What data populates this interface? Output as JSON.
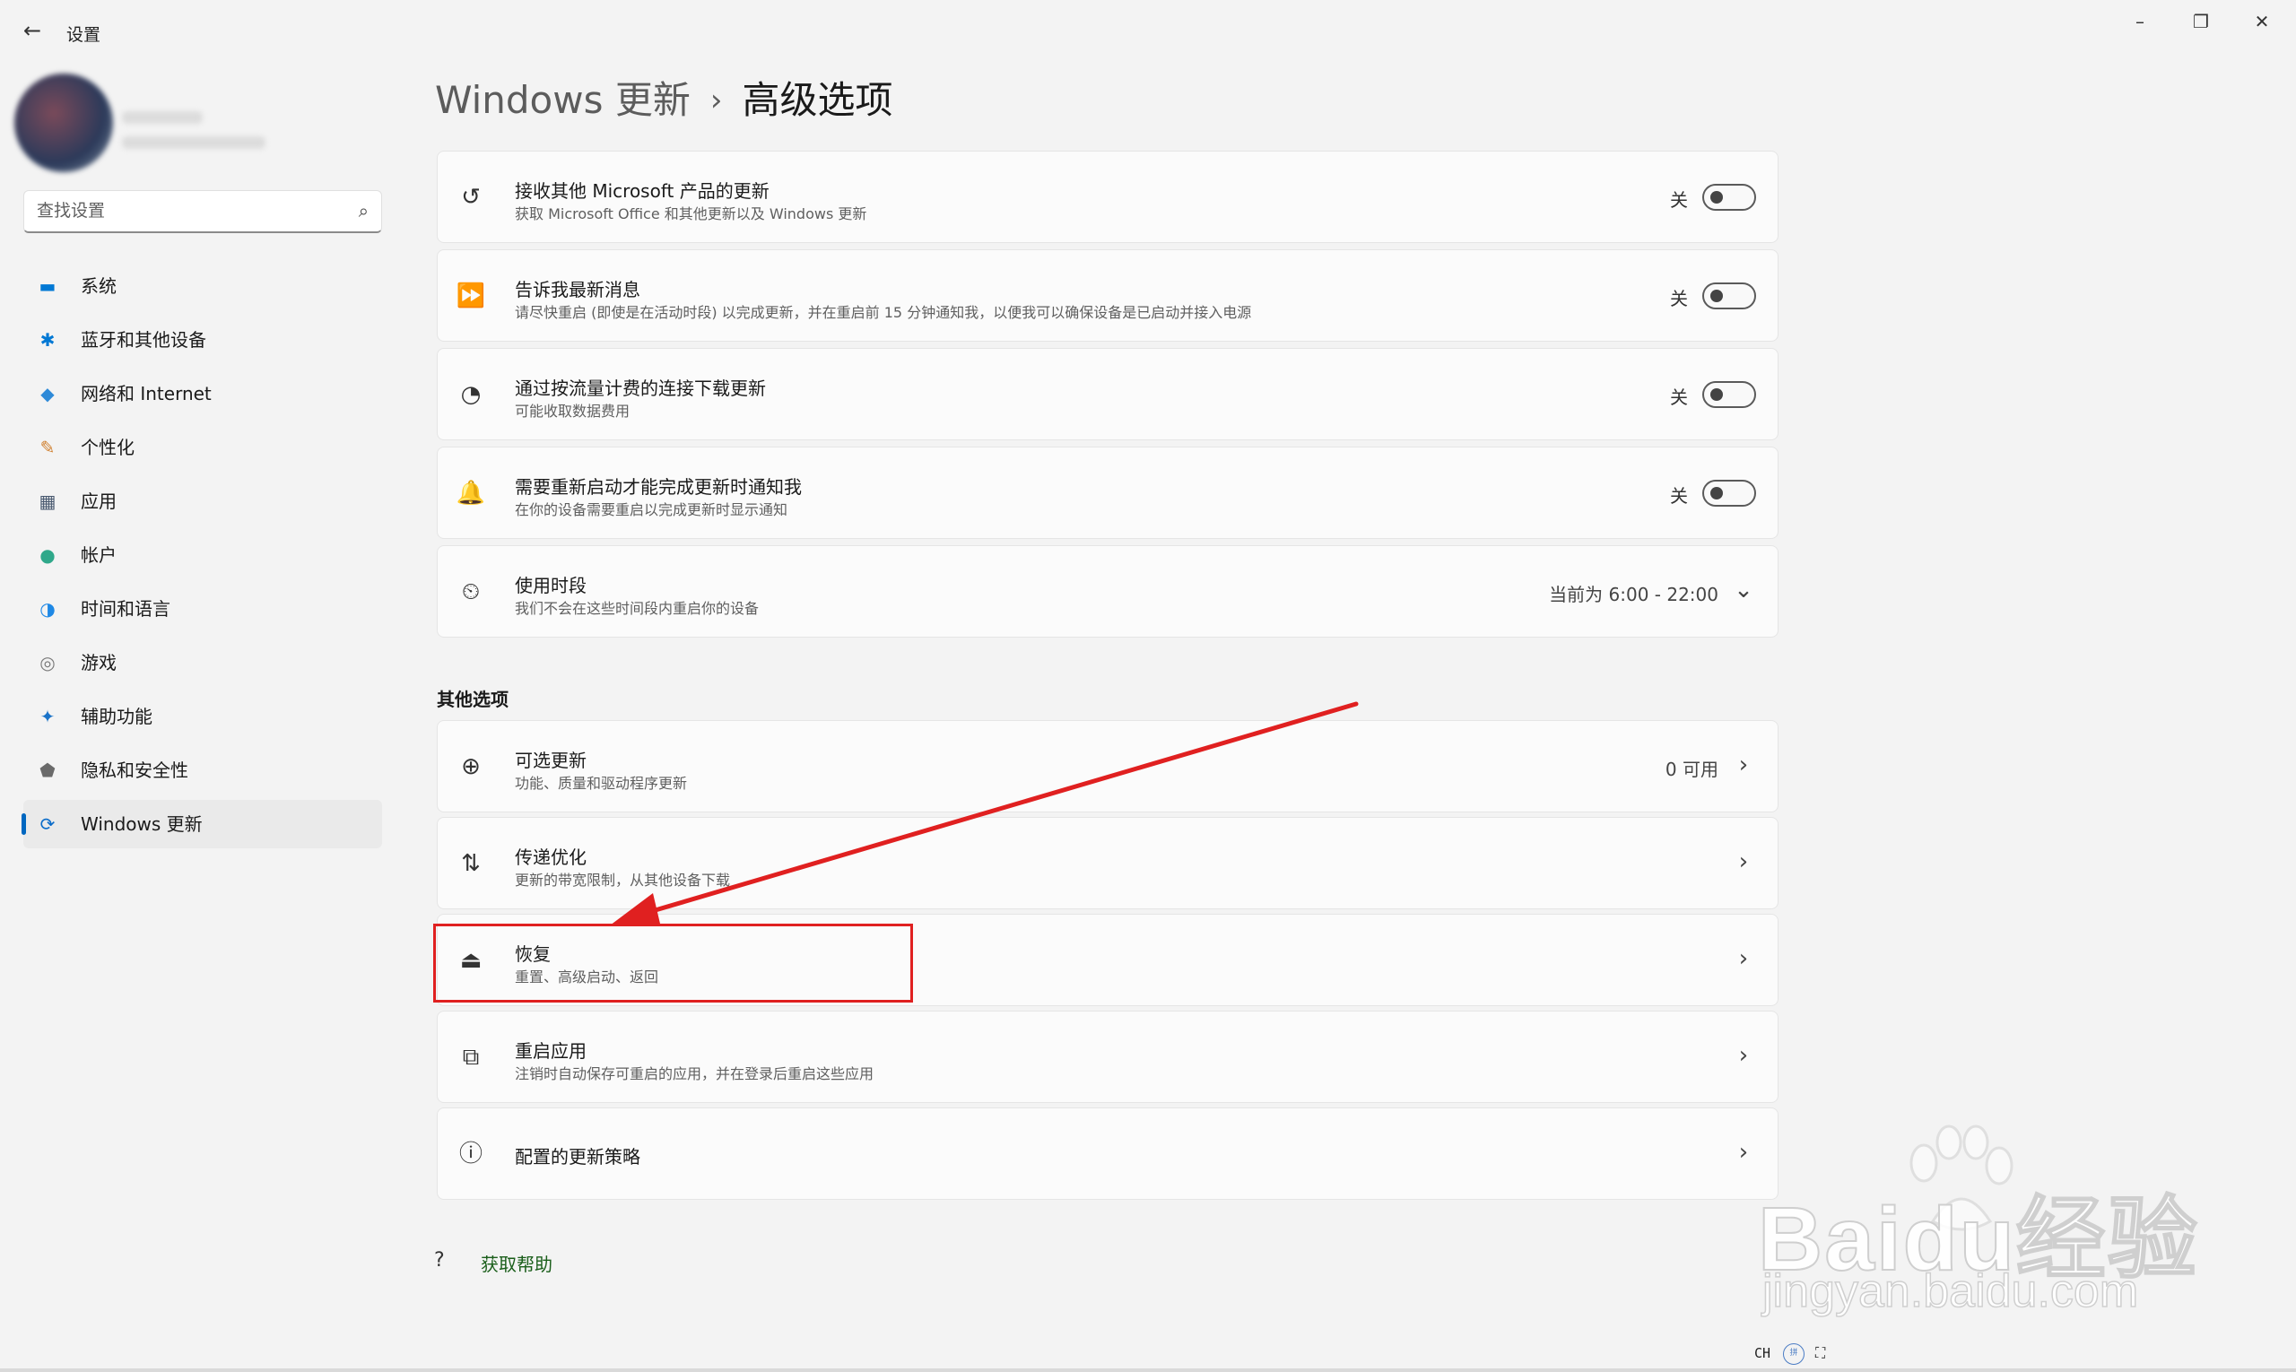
{
  "window": {
    "back": "←",
    "title": "设置",
    "minimize": "–",
    "maximize": "❐",
    "close": "✕"
  },
  "sidebar": {
    "search_placeholder": "查找设置",
    "items": [
      {
        "label": "系统",
        "icon": "▬",
        "color": "#0078d4"
      },
      {
        "label": "蓝牙和其他设备",
        "icon": "✱",
        "color": "#0078d4"
      },
      {
        "label": "网络和 Internet",
        "icon": "◆",
        "color": "#2e8ad8"
      },
      {
        "label": "个性化",
        "icon": "✎",
        "color": "#d08030"
      },
      {
        "label": "应用",
        "icon": "▦",
        "color": "#4a5a70"
      },
      {
        "label": "帐户",
        "icon": "●",
        "color": "#2fa88a"
      },
      {
        "label": "时间和语言",
        "icon": "◑",
        "color": "#1e88e5"
      },
      {
        "label": "游戏",
        "icon": "◎",
        "color": "#7a7a7a"
      },
      {
        "label": "辅助功能",
        "icon": "✦",
        "color": "#1a73c8"
      },
      {
        "label": "隐私和安全性",
        "icon": "⬟",
        "color": "#6a6a6a"
      },
      {
        "label": "Windows 更新",
        "icon": "⟳",
        "color": "#0a6cc9"
      }
    ]
  },
  "breadcrumb": {
    "parent": "Windows 更新",
    "separator": "›",
    "current": "高级选项"
  },
  "toggles": [
    {
      "title": "接收其他 Microsoft 产品的更新",
      "subtitle": "获取 Microsoft Office 和其他更新以及 Windows 更新",
      "state": "关",
      "icon": "↺"
    },
    {
      "title": "告诉我最新消息",
      "subtitle": "请尽快重启 (即使是在活动时段) 以完成更新，并在重启前 15 分钟通知我，以便我可以确保设备是已启动并接入电源",
      "state": "关",
      "icon": "⏩"
    },
    {
      "title": "通过按流量计费的连接下载更新",
      "subtitle": "可能收取数据费用",
      "state": "关",
      "icon": "◔"
    },
    {
      "title": "需要重新启动才能完成更新时通知我",
      "subtitle": "在你的设备需要重启以完成更新时显示通知",
      "state": "关",
      "icon": "🔔"
    }
  ],
  "active_hours": {
    "title": "使用时段",
    "subtitle": "我们不会在这些时间段内重启你的设备",
    "value": "当前为 6:00 - 22:00",
    "icon": "⏲",
    "chevron": "⌄"
  },
  "other_options_title": "其他选项",
  "links": [
    {
      "title": "可选更新",
      "subtitle": "功能、质量和驱动程序更新",
      "value": "0 可用",
      "icon": "⊕"
    },
    {
      "title": "传递优化",
      "subtitle": "更新的带宽限制，从其他设备下载",
      "value": "",
      "icon": "⇅"
    },
    {
      "title": "恢复",
      "subtitle": "重置、高级启动、返回",
      "value": "",
      "icon": "⏏"
    },
    {
      "title": "重启应用",
      "subtitle": "注销时自动保存可重启的应用，并在登录后重启这些应用",
      "value": "",
      "icon": "⧉"
    },
    {
      "title": "配置的更新策略",
      "subtitle": "",
      "value": "",
      "icon": "ⓘ"
    }
  ],
  "chevron": "›",
  "help": {
    "label": "获取帮助",
    "icon": "?"
  },
  "watermark": {
    "main": "Baidu经验",
    "sub": "jingyan.baidu.com"
  },
  "tray": {
    "lang": "CH",
    "ime": "拼",
    "extra": "⛶"
  },
  "annotation_color": "#e02020"
}
